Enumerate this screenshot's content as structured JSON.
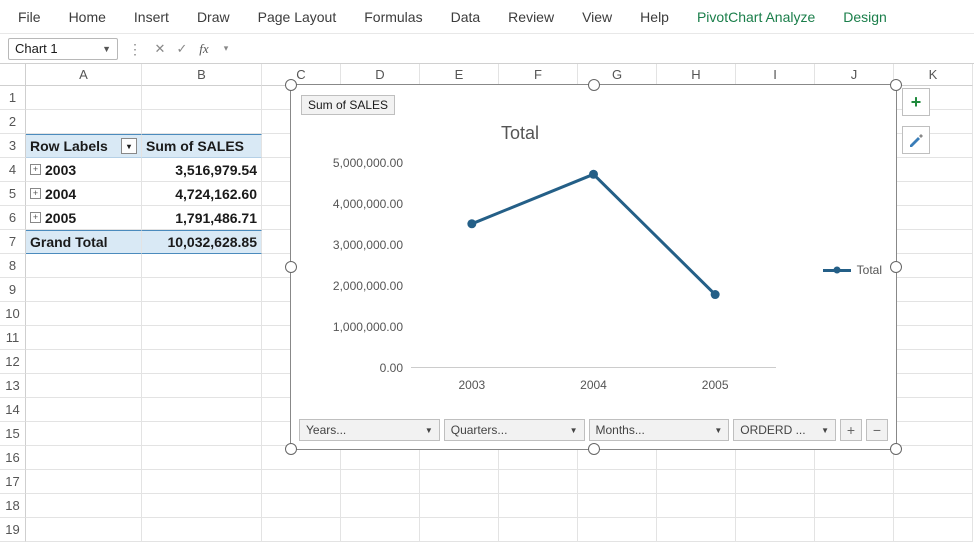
{
  "ribbon": {
    "tabs": [
      "File",
      "Home",
      "Insert",
      "Draw",
      "Page Layout",
      "Formulas",
      "Data",
      "Review",
      "View",
      "Help"
    ],
    "contextual": [
      "PivotChart Analyze",
      "Design"
    ]
  },
  "namebox": {
    "value": "Chart 1"
  },
  "formula_bar": {
    "fx_label": "fx",
    "value": ""
  },
  "columns": [
    "A",
    "B",
    "C",
    "D",
    "E",
    "F",
    "G",
    "H",
    "I",
    "J",
    "K"
  ],
  "row_count": 19,
  "pivot": {
    "header_label": "Row Labels",
    "value_label": "Sum of SALES",
    "rows": [
      {
        "label": "2003",
        "value": "3,516,979.54"
      },
      {
        "label": "2004",
        "value": "4,724,162.60"
      },
      {
        "label": "2005",
        "value": "1,791,486.71"
      }
    ],
    "total_label": "Grand Total",
    "total_value": "10,032,628.85"
  },
  "chart_data": {
    "type": "line",
    "title": "Total",
    "field_title": "Sum of SALES",
    "xlabel": "",
    "ylabel": "",
    "ylim": [
      0,
      5000000
    ],
    "y_ticks": [
      "0.00",
      "1,000,000.00",
      "2,000,000.00",
      "3,000,000.00",
      "4,000,000.00",
      "5,000,000.00"
    ],
    "categories": [
      "2003",
      "2004",
      "2005"
    ],
    "series": [
      {
        "name": "Total",
        "values": [
          3516979.54,
          4724162.6,
          1791486.71
        ]
      }
    ],
    "legend_position": "right",
    "field_buttons": [
      "Years...",
      "Quarters...",
      "Months...",
      "ORDERD ..."
    ]
  },
  "side_tools": {
    "plus": "+",
    "brush": "brush-icon"
  }
}
